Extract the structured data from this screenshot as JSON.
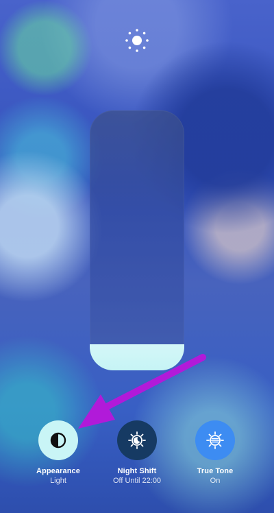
{
  "brightness": {
    "icon": "sun-icon",
    "level": 0.1
  },
  "controls": [
    {
      "title": "Appearance",
      "subtitle": "Light",
      "icon": "appearance-icon"
    },
    {
      "title": "Night Shift",
      "subtitle": "Off Until 22:00",
      "icon": "night-shift-icon"
    },
    {
      "title": "True Tone",
      "subtitle": "On",
      "icon": "true-tone-icon"
    }
  ],
  "colors": {
    "slider_fill": "#c6f4f5",
    "appearance_bg": "#c9f5f6",
    "night_shift_bg": "#163a63",
    "true_tone_bg": "#3d8cf2",
    "annotation_arrow": "#b11ad9"
  }
}
